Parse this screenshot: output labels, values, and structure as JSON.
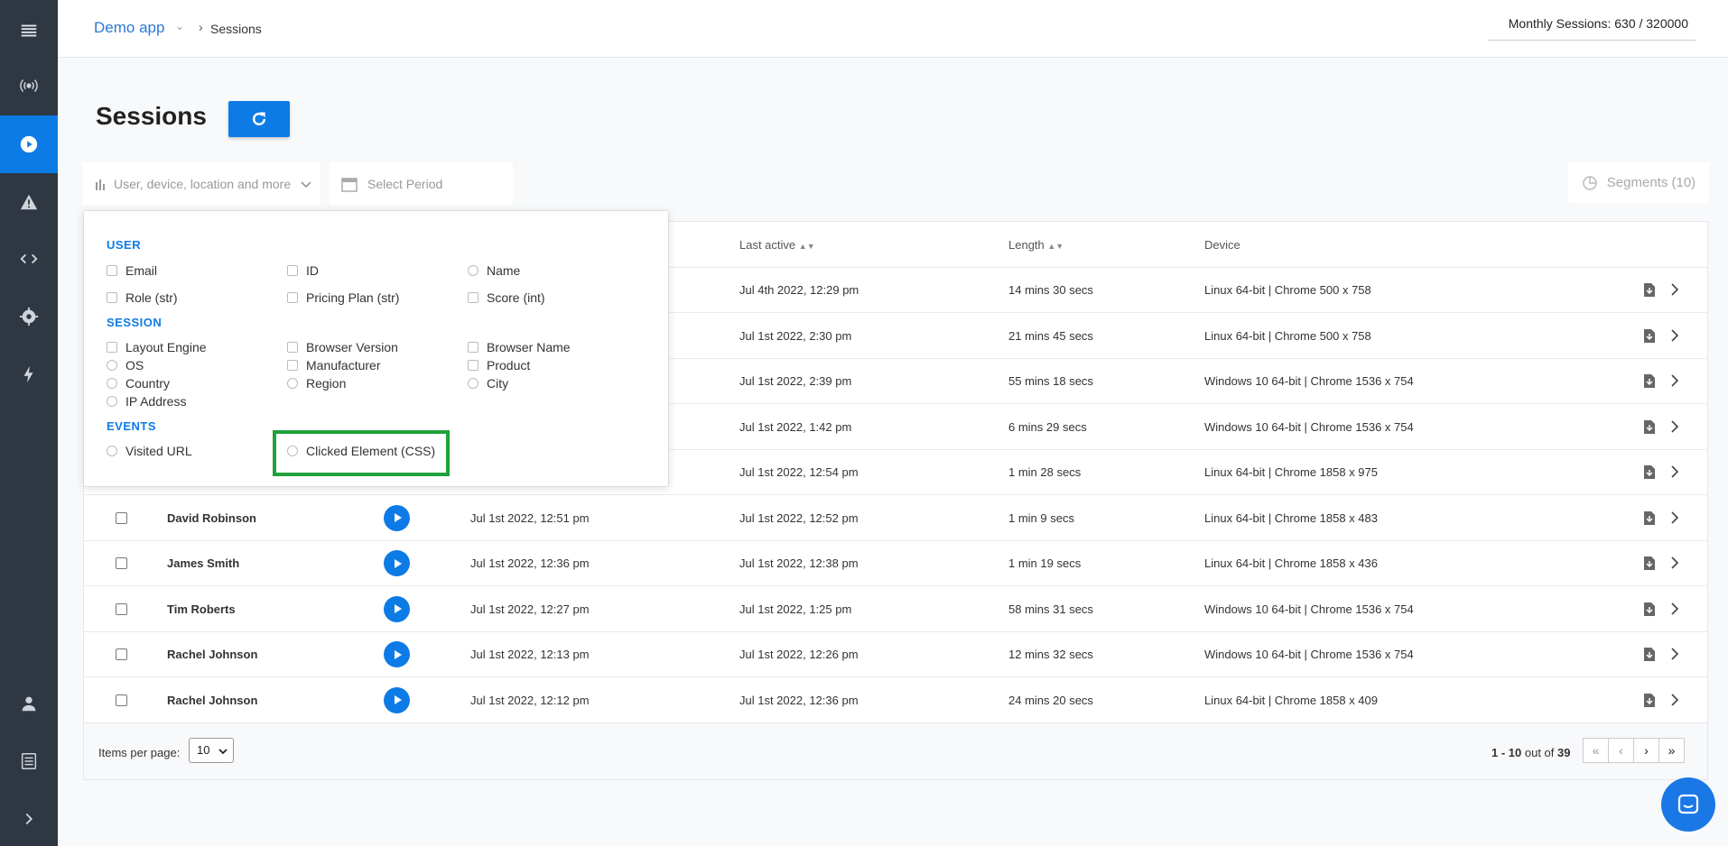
{
  "breadcrumb": {
    "app": "Demo app",
    "current": "Sessions"
  },
  "usage": {
    "text": "Monthly Sessions: 630 / 320000"
  },
  "page": {
    "title": "Sessions"
  },
  "filters": {
    "user_filter_placeholder": "User, device, location and more",
    "period_placeholder": "Select Period",
    "segments_label": "Segments (10)"
  },
  "table": {
    "headers": {
      "last_active": "Last active",
      "length": "Length",
      "device": "Device"
    },
    "rows": [
      {
        "name": "",
        "started": "",
        "last_active": "Jul 4th 2022, 12:29 pm",
        "length": "14 mins 30 secs",
        "device": "Linux 64-bit | Chrome 500 x 758"
      },
      {
        "name": "",
        "started": "",
        "last_active": "Jul 1st 2022, 2:30 pm",
        "length": "21 mins 45 secs",
        "device": "Linux 64-bit | Chrome 500 x 758"
      },
      {
        "name": "",
        "started": "",
        "last_active": "Jul 1st 2022, 2:39 pm",
        "length": "55 mins 18 secs",
        "device": "Windows 10 64-bit | Chrome 1536 x 754"
      },
      {
        "name": "",
        "started": "",
        "last_active": "Jul 1st 2022, 1:42 pm",
        "length": "6 mins 29 secs",
        "device": "Windows 10 64-bit | Chrome 1536 x 754"
      },
      {
        "name": "",
        "started": "",
        "last_active": "Jul 1st 2022, 12:54 pm",
        "length": "1 min 28 secs",
        "device": "Linux 64-bit | Chrome 1858 x 975"
      },
      {
        "name": "David Robinson",
        "started": "Jul 1st 2022, 12:51 pm",
        "last_active": "Jul 1st 2022, 12:52 pm",
        "length": "1 min 9 secs",
        "device": "Linux 64-bit | Chrome 1858 x 483"
      },
      {
        "name": "James Smith",
        "started": "Jul 1st 2022, 12:36 pm",
        "last_active": "Jul 1st 2022, 12:38 pm",
        "length": "1 min 19 secs",
        "device": "Linux 64-bit | Chrome 1858 x 436"
      },
      {
        "name": "Tim Roberts",
        "started": "Jul 1st 2022, 12:27 pm",
        "last_active": "Jul 1st 2022, 1:25 pm",
        "length": "58 mins 31 secs",
        "device": "Windows 10 64-bit | Chrome 1536 x 754"
      },
      {
        "name": "Rachel Johnson",
        "started": "Jul 1st 2022, 12:13 pm",
        "last_active": "Jul 1st 2022, 12:26 pm",
        "length": "12 mins 32 secs",
        "device": "Windows 10 64-bit | Chrome 1536 x 754"
      },
      {
        "name": "Rachel Johnson",
        "started": "Jul 1st 2022, 12:12 pm",
        "last_active": "Jul 1st 2022, 12:36 pm",
        "length": "24 mins 20 secs",
        "device": "Linux 64-bit | Chrome 1858 x 409"
      }
    ]
  },
  "footer": {
    "items_per_page_label": "Items per page:",
    "items_per_page_value": "10",
    "range": "1 - 10",
    "out_of": "out of",
    "total": "39"
  },
  "dropdown": {
    "user_heading": "USER",
    "user_items": [
      "Email",
      "ID",
      "Name",
      "Role (str)",
      "Pricing Plan (str)",
      "Score (int)"
    ],
    "session_heading": "SESSION",
    "session_items": [
      "Layout Engine",
      "Browser Version",
      "Browser Name",
      "OS",
      "Manufacturer",
      "Product",
      "Country",
      "Region",
      "City",
      "IP Address"
    ],
    "events_heading": "EVENTS",
    "event_items": [
      "Visited URL",
      "Clicked Element (CSS)"
    ]
  },
  "colors": {
    "accent": "#0d7be6",
    "sidebar": "#2f3742",
    "highlight": "#1fa23a"
  }
}
